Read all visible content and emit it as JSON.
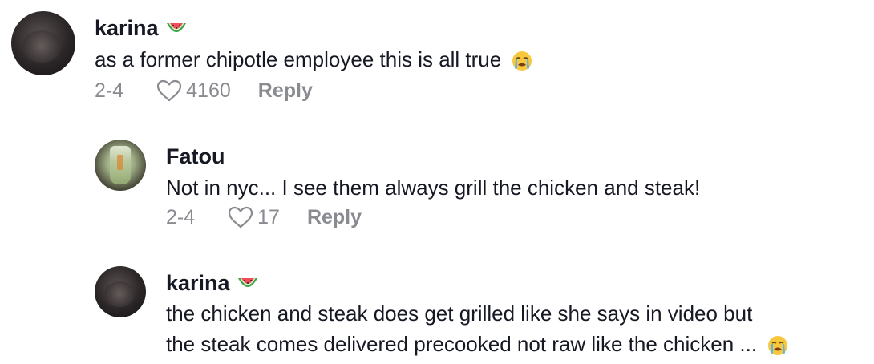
{
  "comments": [
    {
      "user": "karina",
      "text": "as a former chipotle employee this is all true",
      "date": "2-4",
      "likes": "4160",
      "reply_label": "Reply",
      "name_emoji": "watermelon-icon",
      "text_emoji": "crying-face-icon"
    },
    {
      "user": "Fatou",
      "text": "Not in nyc... I see them always grill the chicken and steak!",
      "date": "2-4",
      "likes": "17",
      "reply_label": "Reply"
    },
    {
      "user": "karina",
      "text_line1": "the chicken and steak does get grilled like she says in video but",
      "text_line2": "the steak comes delivered precooked not raw like the chicken ...",
      "name_emoji": "watermelon-icon",
      "text_emoji": "crying-face-icon"
    }
  ],
  "colors": {
    "text": "#161823",
    "meta": "#8a8b91"
  }
}
